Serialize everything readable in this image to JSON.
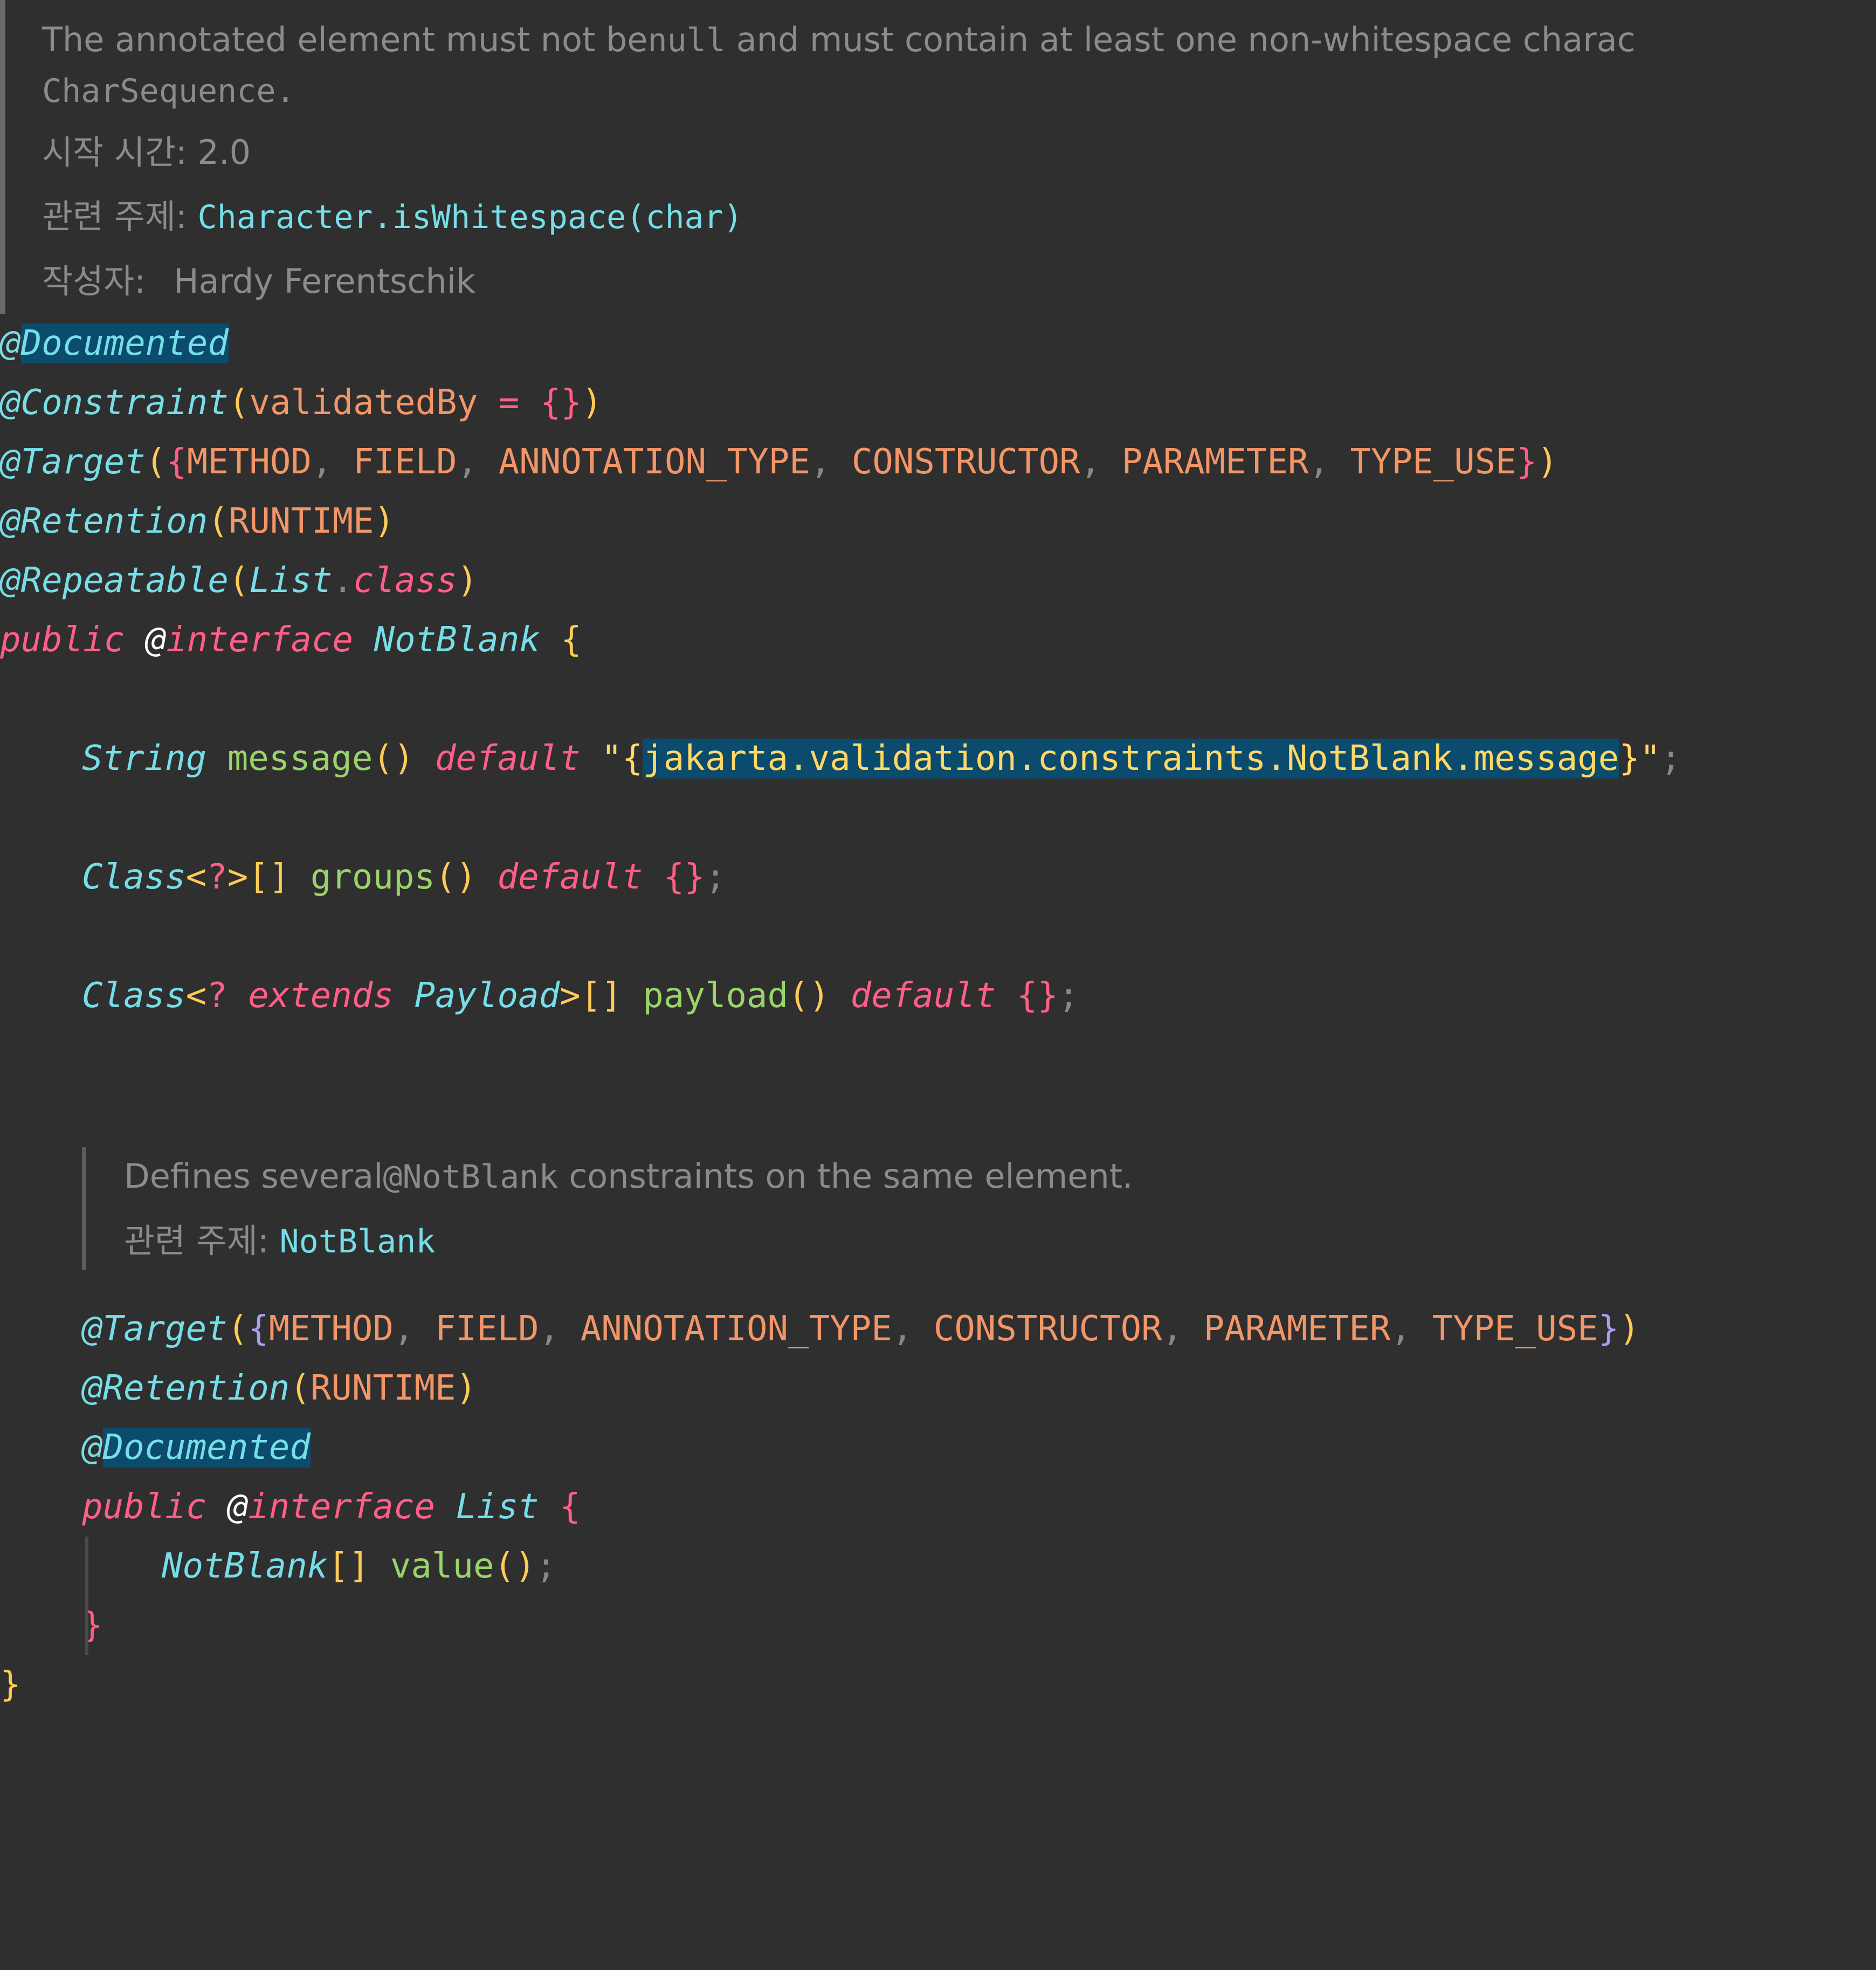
{
  "editor": {
    "language": "java",
    "theme": "dark",
    "background": "#2f2f2f",
    "colors": {
      "doc_text": "#8b8b8b",
      "annotation": "#77dde7",
      "keyword": "#ff5f87",
      "constant": "#f29668",
      "paren": "#ffca57",
      "method": "#9ad36b",
      "string": "#ffd866",
      "punctuation": "#888888",
      "bracket_nested": "#ab9df2",
      "search_highlight": "#0a4b6e"
    }
  },
  "javadoc_class": {
    "description_line1_a": "The annotated element must not be",
    "description_line1_mono": "null",
    "description_line1_b": " and must contain at least one non-whitespace charac",
    "description_line2": "CharSequence.",
    "since_label": "시작 시간:",
    "since_value": "2.0",
    "see_label": "관련 주제:",
    "see_value": "Character.isWhitespace(char)",
    "author_label": "작성자:",
    "author_value": "Hardy Ferentschik"
  },
  "code": {
    "line_documented_at": "@",
    "line_documented_name": "Documented",
    "constraint": {
      "at_name": "@Constraint",
      "lparen": "(",
      "param": "validatedBy",
      "space1": " ",
      "eq": "=",
      "space2": " ",
      "lbrace": "{",
      "rbrace": "}",
      "rparen": ")"
    },
    "target": {
      "at_name": "@Target",
      "lparen": "(",
      "lbrace": "{",
      "values": [
        "METHOD",
        "FIELD",
        "ANNOTATION_TYPE",
        "CONSTRUCTOR",
        "PARAMETER",
        "TYPE_USE"
      ],
      "comma": ", ",
      "rbrace": "}",
      "rparen": ")"
    },
    "retention": {
      "at_name": "@Retention",
      "lparen": "(",
      "value": "RUNTIME",
      "rparen": ")"
    },
    "repeatable": {
      "at_name": "@Repeatable",
      "lparen": "(",
      "type": "List",
      "dot": ".",
      "keyword": "class",
      "rparen": ")"
    },
    "decl": {
      "modifier": "public",
      "at": "@",
      "keyword": "interface",
      "name": "NotBlank",
      "lbrace": "{"
    },
    "message_member": {
      "type": "String",
      "name": "message",
      "parens": "()",
      "default_kw": "default",
      "quote": "\"",
      "str_open_brace": "{",
      "str_body": "jakarta.validation.constraints.NotBlank.message",
      "str_close_brace": "}",
      "semi": ";"
    },
    "groups_member": {
      "type": "Class",
      "lt": "<",
      "wildcard": "?",
      "gt": ">",
      "brackets": "[]",
      "name": "groups",
      "parens": "()",
      "default_kw": "default",
      "value": "{}",
      "semi": ";"
    },
    "payload_member": {
      "type": "Class",
      "lt": "<",
      "wildcard": "?",
      "extends_kw": "extends",
      "bound": "Payload",
      "gt": ">",
      "brackets": "[]",
      "name": "payload",
      "parens": "()",
      "default_kw": "default",
      "value": "{}",
      "semi": ";"
    },
    "javadoc_list": {
      "description_a": "Defines several",
      "description_mono": "@NotBlank",
      "description_b": " constraints on the same element.",
      "see_label": "관련 주제:",
      "see_value": "NotBlank"
    },
    "list_decl": {
      "modifier": "public",
      "at": "@",
      "keyword": "interface",
      "name": "List",
      "lbrace": "{"
    },
    "value_member": {
      "type": "NotBlank",
      "brackets": "[]",
      "name": "value",
      "parens": "()",
      "semi": ";"
    },
    "close_inner": "}",
    "close_outer": "}"
  }
}
